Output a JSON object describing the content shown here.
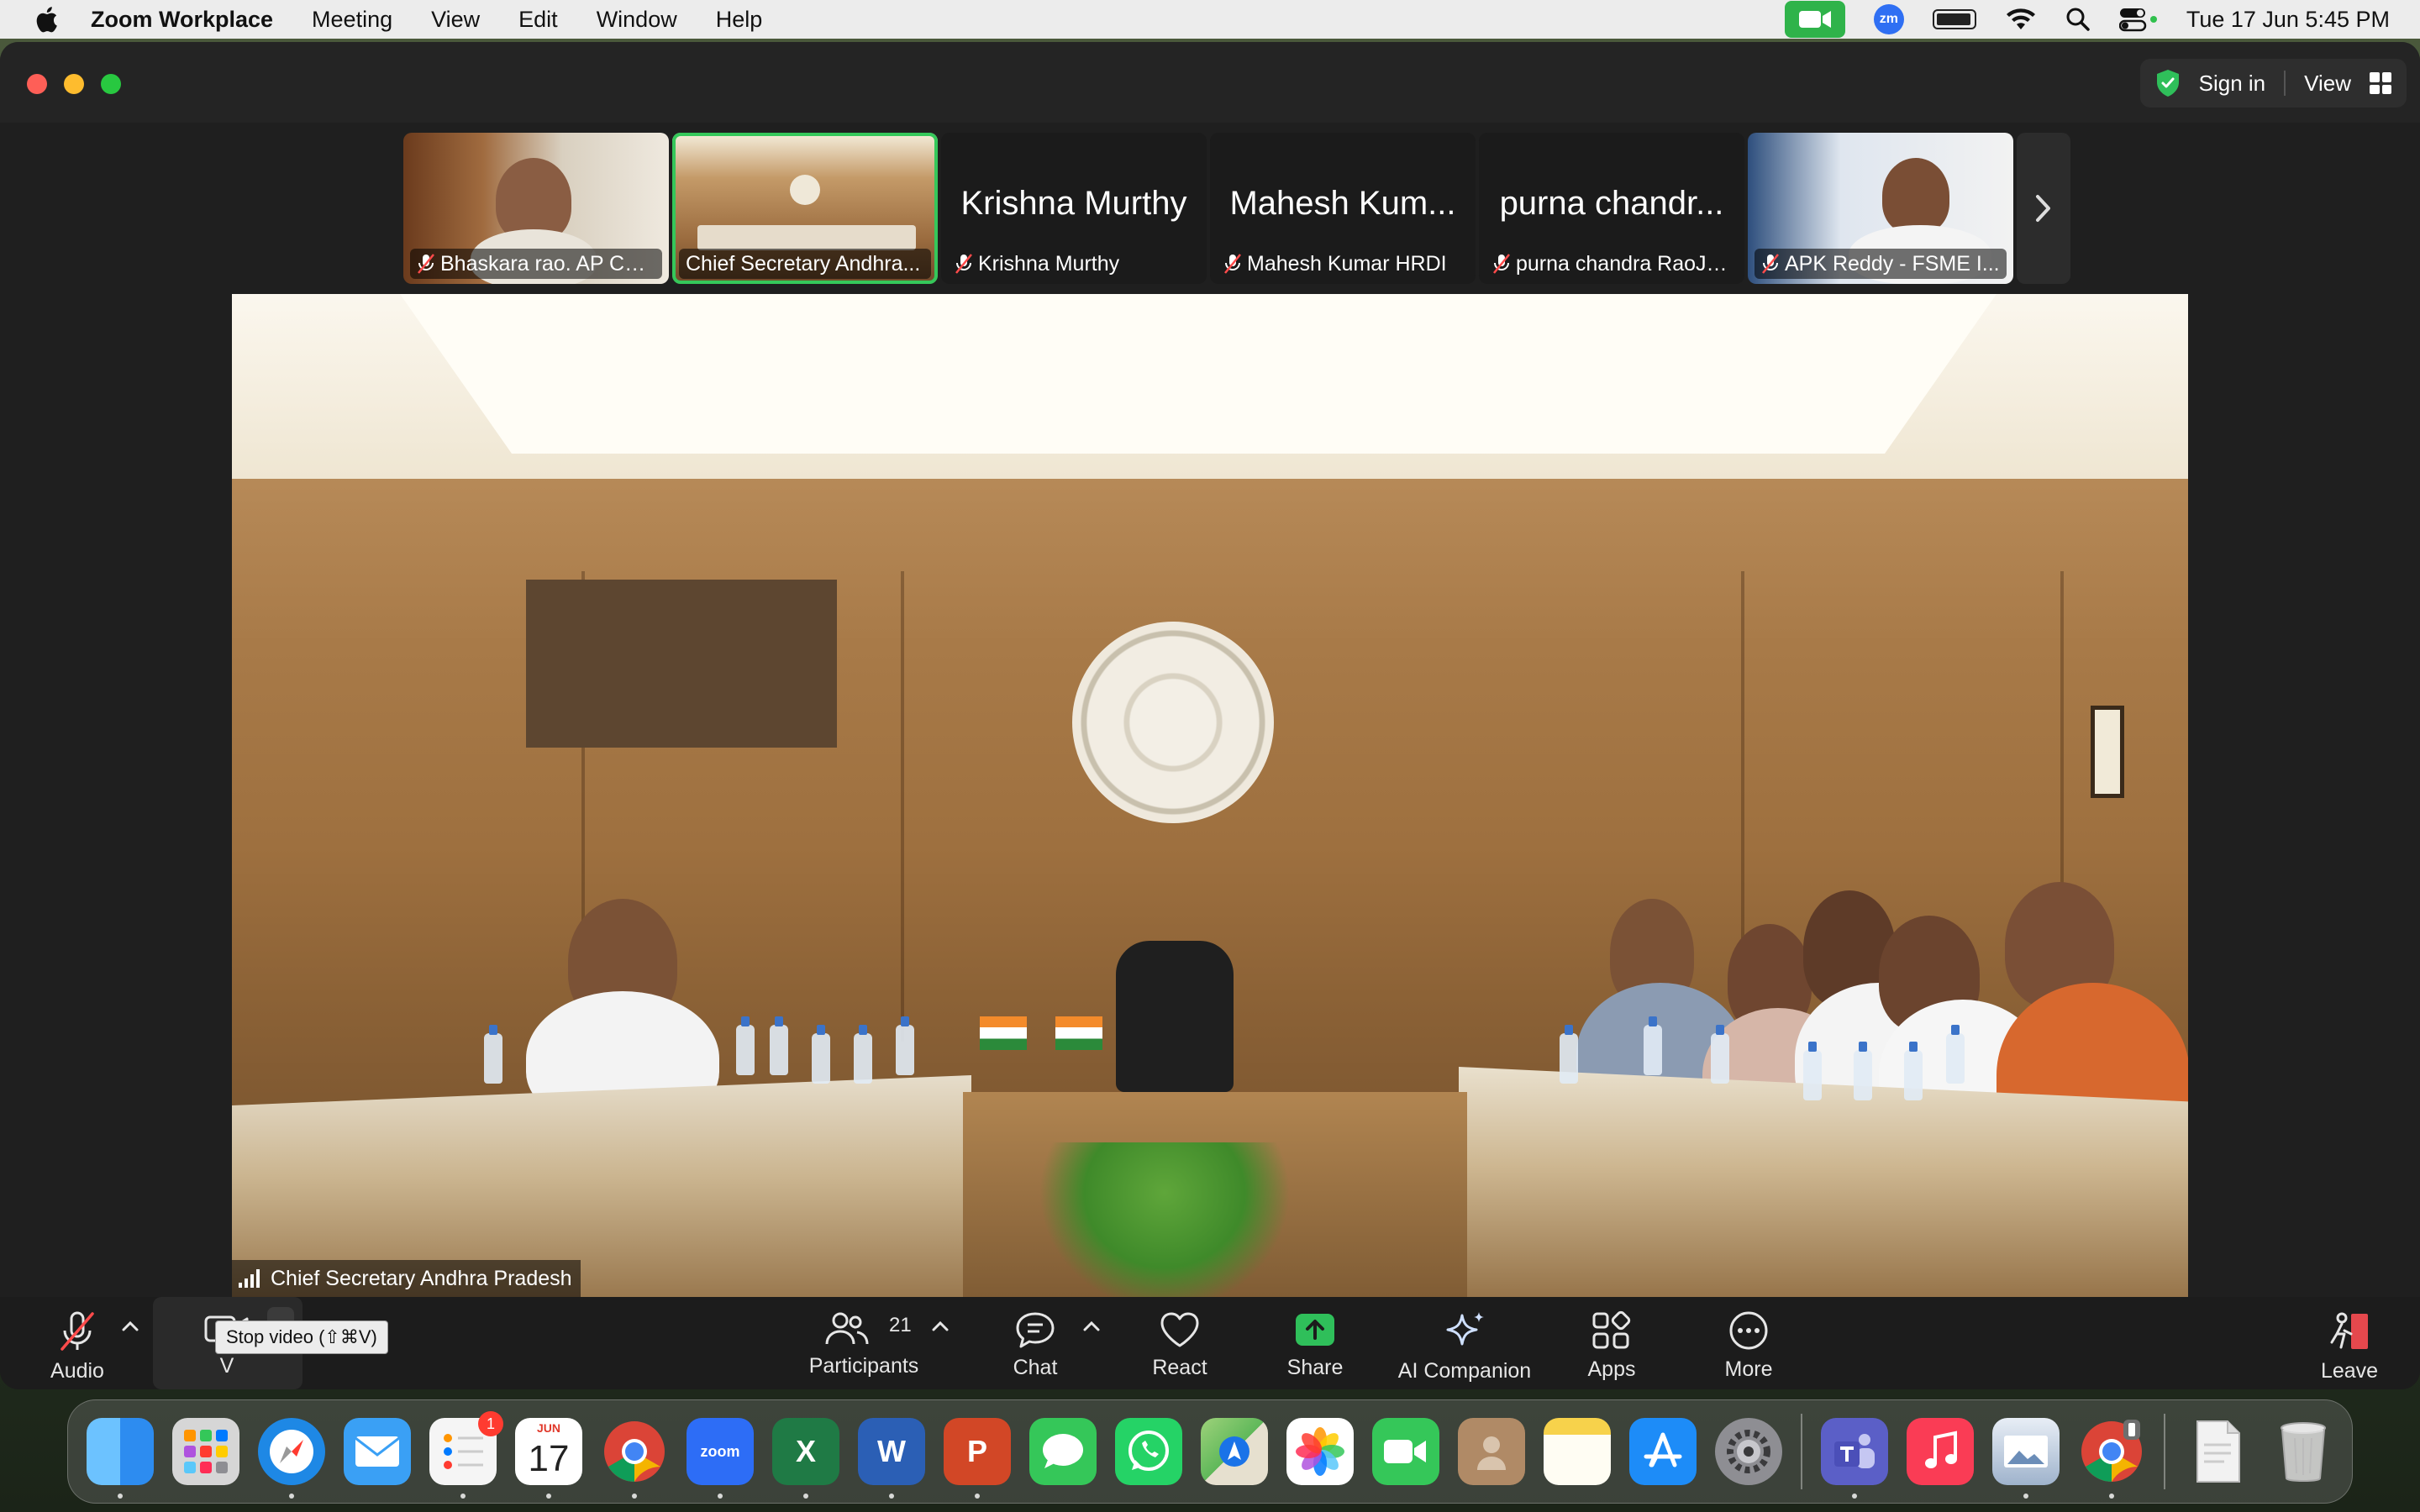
{
  "menubar": {
    "app_name": "Zoom Workplace",
    "items": [
      "Meeting",
      "View",
      "Edit",
      "Window",
      "Help"
    ],
    "clock": "Tue 17 Jun  5:45 PM",
    "zoom_status_label": "zm"
  },
  "titlebar": {
    "sign_in": "Sign in",
    "view": "View"
  },
  "thumbnails": [
    {
      "name": "Bhaskara rao. AP CH...",
      "big_name": "",
      "has_video": true,
      "muted": true,
      "active": false
    },
    {
      "name": "Chief Secretary Andhra...",
      "big_name": "",
      "has_video": true,
      "muted": false,
      "active": true
    },
    {
      "name": "Krishna Murthy",
      "big_name": "Krishna Murthy",
      "has_video": false,
      "muted": true,
      "active": false
    },
    {
      "name": "Mahesh Kumar HRDI",
      "big_name": "Mahesh Kum...",
      "has_video": false,
      "muted": true,
      "active": false
    },
    {
      "name": "purna chandra RaoJo...",
      "big_name": "purna chandr...",
      "has_video": false,
      "muted": true,
      "active": false
    },
    {
      "name": "APK Reddy - FSME I...",
      "big_name": "",
      "has_video": true,
      "muted": true,
      "active": false
    }
  ],
  "main_video": {
    "speaker_name": "Chief Secretary Andhra Pradesh"
  },
  "controls": {
    "audio": "Audio",
    "video": "V",
    "participants": "Participants",
    "participant_count": "21",
    "chat": "Chat",
    "react": "React",
    "share": "Share",
    "ai_companion": "AI Companion",
    "apps": "Apps",
    "more": "More",
    "leave": "Leave",
    "tooltip": "Stop video (⇧⌘V)"
  },
  "dock": {
    "items": [
      {
        "id": "finder",
        "label": "",
        "color": "#2d8cf0"
      },
      {
        "id": "launchpad",
        "label": "",
        "color": "#d6d6d6"
      },
      {
        "id": "safari",
        "label": "",
        "color": "#1e88e5"
      },
      {
        "id": "mail",
        "label": "",
        "color": "#3aa0f5"
      },
      {
        "id": "reminders",
        "label": "",
        "color": "#f5f5f5",
        "badge": "1"
      },
      {
        "id": "calendar",
        "label": "",
        "color": "#ffffff",
        "month": "JUN",
        "day": "17"
      },
      {
        "id": "chrome",
        "label": "",
        "color": "#ffffff"
      },
      {
        "id": "zoom",
        "label": "zoom",
        "color": "#2d6df6"
      },
      {
        "id": "excel",
        "label": "X",
        "color": "#1f7a45"
      },
      {
        "id": "word",
        "label": "W",
        "color": "#2b5fb5"
      },
      {
        "id": "powerpoint",
        "label": "P",
        "color": "#d24726"
      },
      {
        "id": "messages",
        "label": "",
        "color": "#35c759"
      },
      {
        "id": "whatsapp",
        "label": "",
        "color": "#25d366"
      },
      {
        "id": "maps",
        "label": "",
        "color": "#5fb85a"
      },
      {
        "id": "photos",
        "label": "",
        "color": "#ffffff"
      },
      {
        "id": "facetime",
        "label": "",
        "color": "#35c759"
      },
      {
        "id": "contacts",
        "label": "",
        "color": "#b08a66"
      },
      {
        "id": "notes",
        "label": "",
        "color": "#f7d24b"
      },
      {
        "id": "app-store",
        "label": "",
        "color": "#1d8cf8"
      },
      {
        "id": "system-settings",
        "label": "",
        "color": "#8e8e93"
      },
      {
        "id": "teams",
        "label": "",
        "color": "#5b5fc7"
      },
      {
        "id": "music",
        "label": "",
        "color": "#fa3c55"
      },
      {
        "id": "preview",
        "label": "",
        "color": "#c9d6e6"
      },
      {
        "id": "chrome-2",
        "label": "",
        "color": "#ffffff"
      },
      {
        "id": "document",
        "label": "",
        "color": "#f0f0f0"
      },
      {
        "id": "trash",
        "label": "",
        "color": "#d8d8d8"
      }
    ]
  }
}
